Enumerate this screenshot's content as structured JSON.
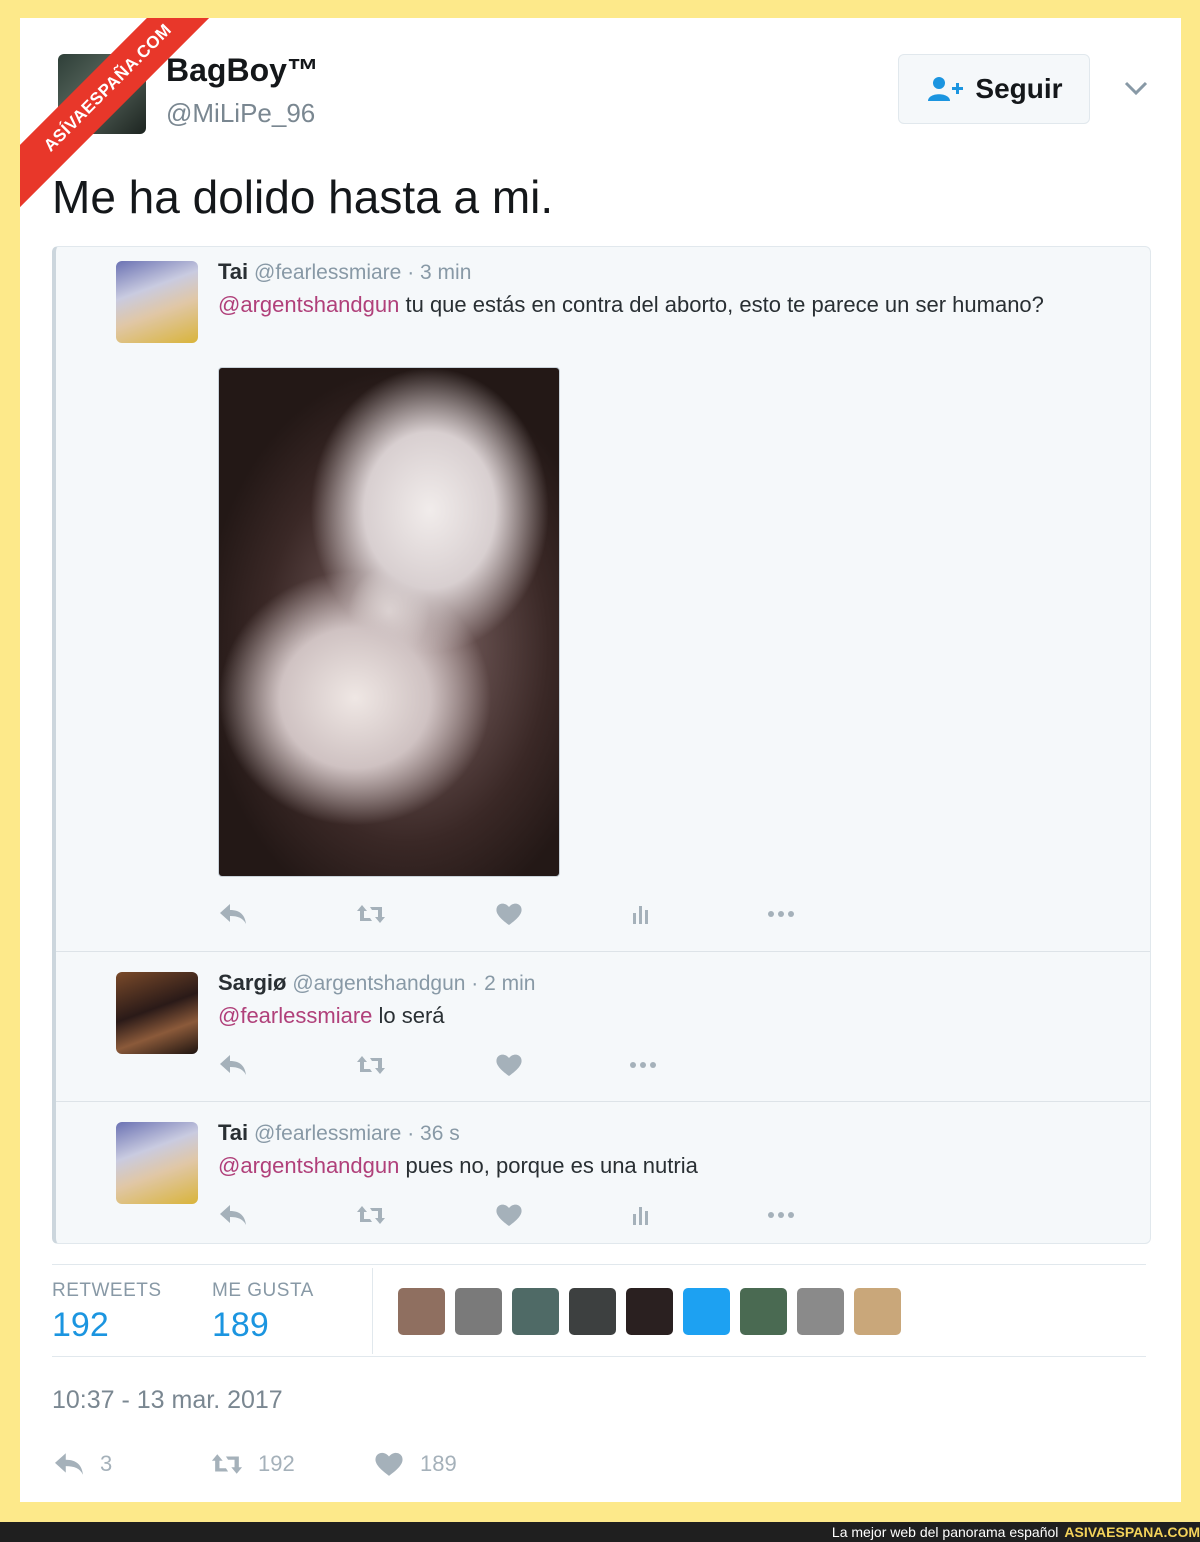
{
  "watermark": {
    "ribbon_text": "ASÍVAESPAÑA.COM"
  },
  "tweet": {
    "user_name": "BagBoy™",
    "user_handle": "@MiLiPe_96",
    "follow_label": "Seguir",
    "text": "Me ha dolido hasta a mi."
  },
  "embedded_thread": {
    "replies": [
      {
        "name": "Tai",
        "handle": "@fearlessmiare",
        "time": "· 3 min",
        "mention": "@argentshandgun",
        "text": " tu que estás en contra del aborto, esto te parece un ser humano?",
        "has_image": true
      },
      {
        "name": "Sargiø",
        "handle": "@argentshandgun",
        "time": "· 2 min",
        "mention": "@fearlessmiare",
        "text": " lo será",
        "has_image": false
      },
      {
        "name": "Tai",
        "handle": "@fearlessmiare",
        "time": "· 36 s",
        "mention": "@argentshandgun",
        "text": " pues no, porque es una nutria",
        "has_image": false
      }
    ]
  },
  "stats": {
    "retweets_label": "RETWEETS",
    "retweets_value": "192",
    "likes_label": "ME GUSTA",
    "likes_value": "189",
    "liker_colors": [
      "#8f6f60",
      "#7a7a7a",
      "#4f6a66",
      "#3d4040",
      "#2a2020",
      "#1da1f2",
      "#4a6a52",
      "#8a8a8a",
      "#c9a77a"
    ]
  },
  "timestamp": "10:37 - 13 mar. 2017",
  "bottom_actions": {
    "reply_count": "3",
    "retweet_count": "192",
    "like_count": "189"
  },
  "footer": {
    "tagline": "La mejor web del panorama español",
    "site": "ASIVAESPANA.COM"
  }
}
